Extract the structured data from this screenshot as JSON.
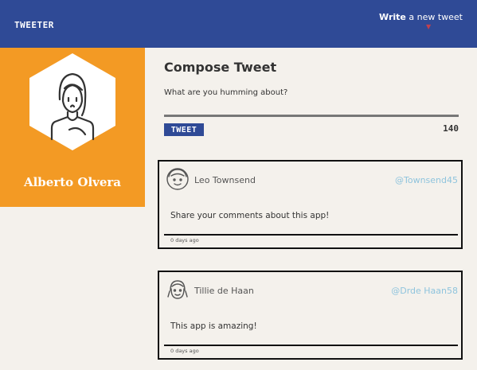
{
  "header": {
    "logo": "TWEETER",
    "write_bold": "Write",
    "write_rest": " a new tweet",
    "caret_icon": "chevron-down-icon"
  },
  "profile": {
    "name": "Alberto Olvera",
    "avatar_icon": "person-avatar-icon",
    "bg_color": "#f39a24"
  },
  "compose": {
    "title": "Compose Tweet",
    "placeholder": "What are you humming about?",
    "button_label": "TWEET",
    "counter": "140"
  },
  "tweets": [
    {
      "name": "Leo Townsend",
      "handle": "@Townsend45",
      "text": "Share your comments about this app!",
      "age": "0 days ago"
    },
    {
      "name": "Tillie de Haan",
      "handle": "@Drde Haan58",
      "text": "This app is amazing!",
      "age": "0 days ago"
    }
  ],
  "colors": {
    "header": "#2f4a96",
    "accent": "#f39a24",
    "handle": "#8fc4dd",
    "background": "#f4f1ec"
  }
}
